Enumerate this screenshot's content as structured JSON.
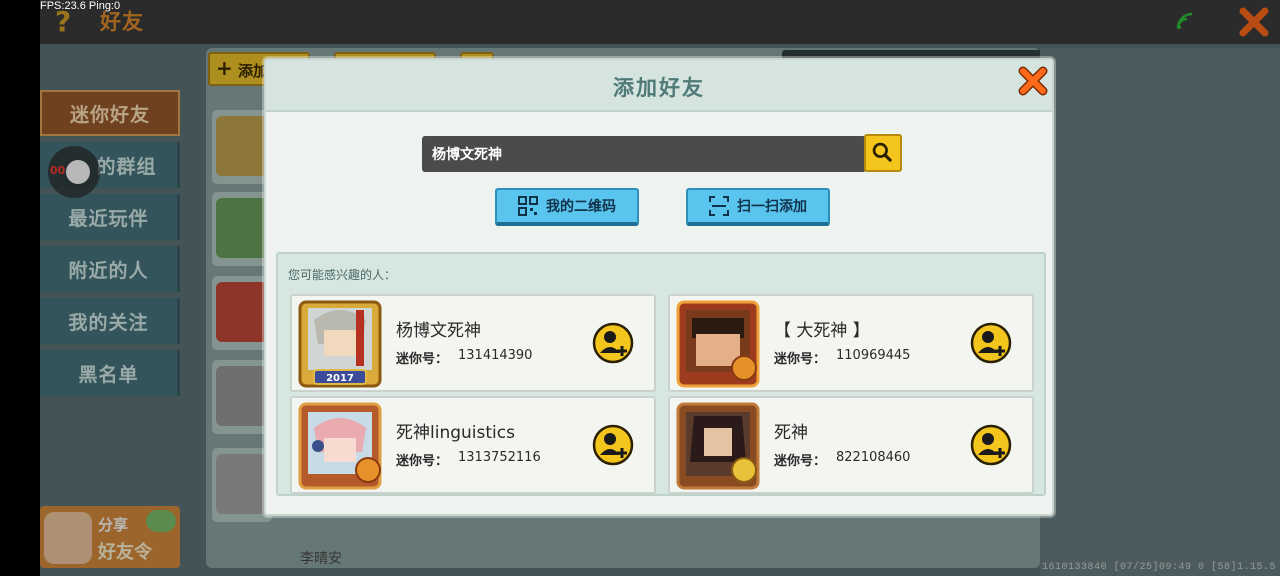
{
  "hud": {
    "fps_ping": "FPS:23.6  Ping:0"
  },
  "topbar": {
    "title": "好友",
    "help_label": "?"
  },
  "sidebar": {
    "items": [
      {
        "label": "迷你好友",
        "active": true
      },
      {
        "label": "的群组",
        "active": false
      },
      {
        "label": "最近玩伴",
        "active": false
      },
      {
        "label": "附近的人",
        "active": false
      },
      {
        "label": "我的关注",
        "active": false
      },
      {
        "label": "黑名单",
        "active": false
      }
    ]
  },
  "joystick": {
    "rec_label": "00"
  },
  "share": {
    "line1": "分享",
    "line2": "好友令"
  },
  "background": {
    "add_button_label": "添加",
    "bottom_name": "李晴安",
    "status_line": "1610133840    [07/25]09:49 0  [58]1.15.5"
  },
  "dialog": {
    "title": "添加好友",
    "search": {
      "value": "杨博文死神"
    },
    "buttons": {
      "my_qr": "我的二维码",
      "scan_add": "扫一扫添加"
    },
    "suggest_label": "您可能感兴趣的人：",
    "id_prefix": "迷你号：",
    "people": [
      {
        "name": "杨博文死神",
        "id": "131414390",
        "badge": "2017"
      },
      {
        "name": "【 大死神 】",
        "id": "110969445"
      },
      {
        "name": "死神linguistics",
        "id": "1313752116"
      },
      {
        "name": "死神",
        "id": "822108460"
      }
    ]
  },
  "colors": {
    "accent": "#f4c51d",
    "title_teal": "#4f7a78",
    "close_orange": "#ff6a1a",
    "button_blue": "#59c4ee"
  }
}
